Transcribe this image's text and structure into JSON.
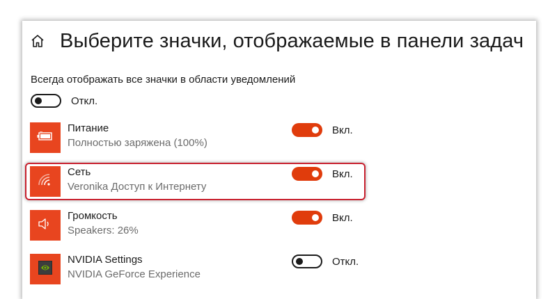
{
  "page": {
    "title": "Выберите значки, отображаемые в панели задач",
    "home_icon": "home-icon"
  },
  "always_show": {
    "label": "Всегда отображать все значки в области уведомлений",
    "state_label": "Откл.",
    "is_on": false
  },
  "items": [
    {
      "title": "Питание",
      "subtitle": "Полностью заряжена (100%)",
      "icon": "battery-icon",
      "state_label": "Вкл.",
      "is_on": true
    },
    {
      "title": "Сеть",
      "subtitle": "Veronika Доступ к Интернету",
      "icon": "wifi-icon",
      "state_label": "Вкл.",
      "is_on": true
    },
    {
      "title": "Громкость",
      "subtitle": "Speakers: 26%",
      "icon": "speaker-icon",
      "state_label": "Вкл.",
      "is_on": true
    },
    {
      "title": "NVIDIA Settings",
      "subtitle": "NVIDIA GeForce Experience",
      "icon": "nvidia-icon",
      "state_label": "Откл.",
      "is_on": false
    }
  ],
  "colors": {
    "accent": "#e03c0c",
    "tile": "#e8451f",
    "highlight_border": "#c8202e"
  }
}
